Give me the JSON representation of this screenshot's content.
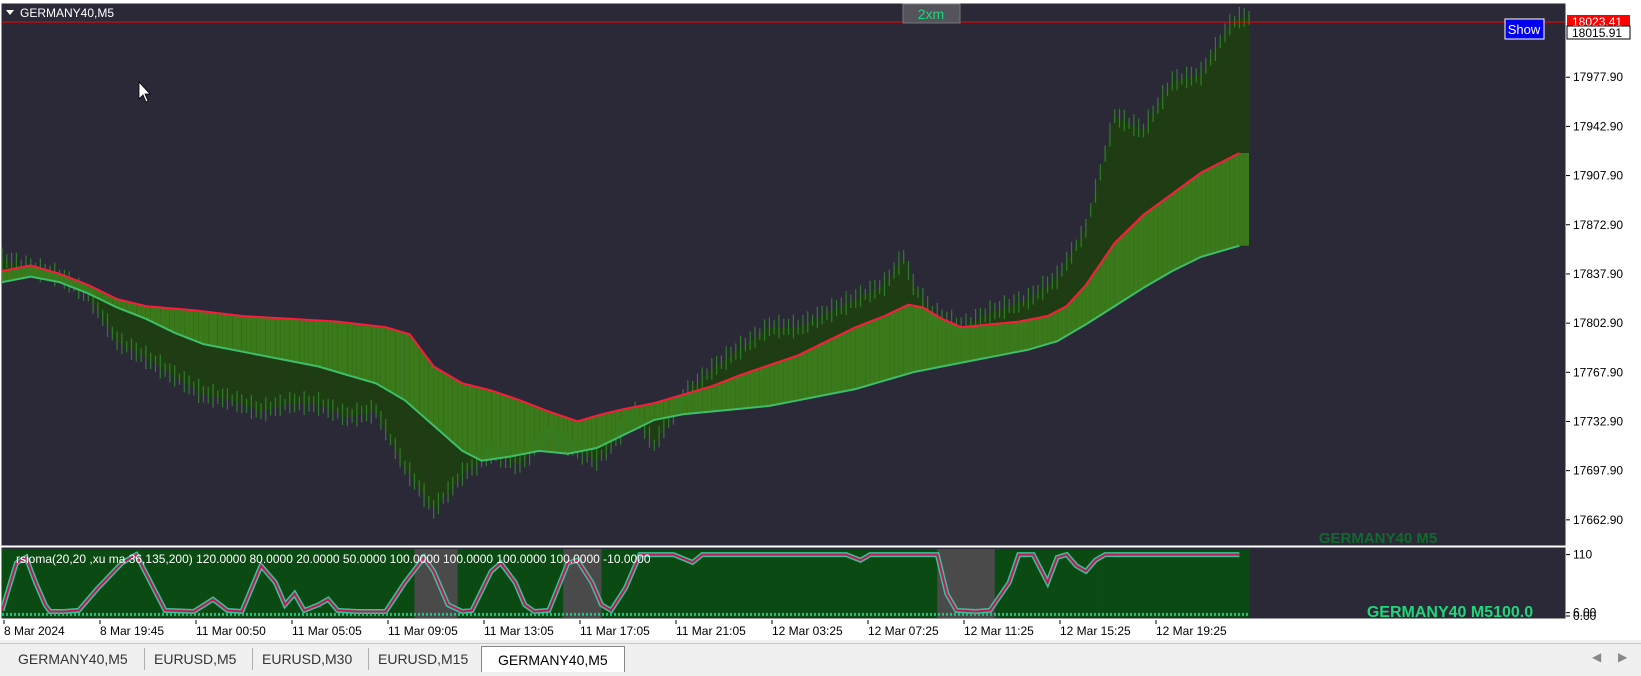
{
  "window": {
    "title": "GERMANY40,M5",
    "timeframe_button": "2xm",
    "show_button": "Show",
    "watermark_main": "GERMANY40 M5",
    "watermark_sub": "GERMANY40 M5100.0"
  },
  "colors": {
    "background": "#2b2937",
    "bear_fill": "#6b0000",
    "bull_fill": "#3a7a1a",
    "bull_band": "#1f3d12",
    "fast_line_bear": "#ff1a3c",
    "slow_line_bull": "#3dbf6a",
    "watermark": "#1fd67a",
    "price_line": "#ff0000"
  },
  "chart_data": [
    {
      "type": "line",
      "title": "GERMANY40,M5",
      "ylim": [
        17645,
        18030
      ],
      "y_ticks": [
        "17977.90",
        "17942.90",
        "17907.90",
        "17872.90",
        "17837.90",
        "17802.90",
        "17767.90",
        "17732.90",
        "17697.90",
        "17662.90"
      ],
      "current_price_labels": [
        "18023.41",
        "18015.91"
      ],
      "x_ticks": [
        "8 Mar 2024",
        "8 Mar 19:45",
        "11 Mar 00:50",
        "11 Mar 05:05",
        "11 Mar 09:05",
        "11 Mar 13:05",
        "11 Mar 17:05",
        "11 Mar 21:05",
        "12 Mar 03:25",
        "12 Mar 07:25",
        "12 Mar 11:25",
        "12 Mar 15:25",
        "12 Mar 19:25"
      ],
      "x_index_range": [
        0,
        260
      ],
      "series": [
        {
          "role": "price",
          "points": [
            [
              0,
              17848
            ],
            [
              6,
              17842
            ],
            [
              12,
              17836
            ],
            [
              18,
              17823
            ],
            [
              24,
              17790
            ],
            [
              30,
              17778
            ],
            [
              36,
              17765
            ],
            [
              42,
              17752
            ],
            [
              48,
              17748
            ],
            [
              54,
              17740
            ],
            [
              60,
              17746
            ],
            [
              66,
              17745
            ],
            [
              72,
              17736
            ],
            [
              78,
              17740
            ],
            [
              84,
              17700
            ],
            [
              90,
              17670
            ],
            [
              96,
              17695
            ],
            [
              102,
              17710
            ],
            [
              108,
              17702
            ],
            [
              114,
              17725
            ],
            [
              120,
              17712
            ],
            [
              124,
              17705
            ],
            [
              128,
              17720
            ],
            [
              132,
              17738
            ],
            [
              136,
              17716
            ],
            [
              142,
              17750
            ],
            [
              148,
              17770
            ],
            [
              154,
              17785
            ],
            [
              160,
              17800
            ],
            [
              166,
              17800
            ],
            [
              172,
              17810
            ],
            [
              178,
              17820
            ],
            [
              184,
              17830
            ],
            [
              188,
              17850
            ],
            [
              190,
              17830
            ],
            [
              194,
              17810
            ],
            [
              200,
              17800
            ],
            [
              206,
              17810
            ],
            [
              214,
              17820
            ],
            [
              220,
              17835
            ],
            [
              226,
              17870
            ],
            [
              232,
              17950
            ],
            [
              238,
              17940
            ],
            [
              244,
              17975
            ],
            [
              250,
              17980
            ],
            [
              256,
              18015
            ],
            [
              258,
              18020
            ]
          ]
        },
        {
          "role": "fast_ma",
          "points": [
            [
              0,
              17840
            ],
            [
              6,
              17844
            ],
            [
              12,
              17838
            ],
            [
              18,
              17830
            ],
            [
              24,
              17820
            ],
            [
              30,
              17815
            ],
            [
              40,
              17812
            ],
            [
              50,
              17808
            ],
            [
              60,
              17806
            ],
            [
              70,
              17804
            ],
            [
              80,
              17800
            ],
            [
              85,
              17795
            ],
            [
              90,
              17772
            ],
            [
              96,
              17760
            ],
            [
              102,
              17755
            ],
            [
              108,
              17748
            ],
            [
              114,
              17740
            ],
            [
              120,
              17733
            ],
            [
              125,
              17738
            ],
            [
              130,
              17742
            ],
            [
              136,
              17746
            ],
            [
              142,
              17752
            ],
            [
              148,
              17758
            ],
            [
              154,
              17766
            ],
            [
              160,
              17773
            ],
            [
              166,
              17780
            ],
            [
              172,
              17790
            ],
            [
              178,
              17800
            ],
            [
              184,
              17808
            ],
            [
              189,
              17816
            ],
            [
              192,
              17814
            ],
            [
              196,
              17806
            ],
            [
              200,
              17800
            ],
            [
              206,
              17802
            ],
            [
              212,
              17804
            ],
            [
              218,
              17808
            ],
            [
              222,
              17815
            ],
            [
              226,
              17830
            ],
            [
              232,
              17860
            ],
            [
              238,
              17880
            ],
            [
              244,
              17895
            ],
            [
              250,
              17910
            ],
            [
              258,
              17924
            ]
          ]
        },
        {
          "role": "slow_ma",
          "points": [
            [
              0,
              17832
            ],
            [
              6,
              17836
            ],
            [
              12,
              17832
            ],
            [
              18,
              17824
            ],
            [
              24,
              17814
            ],
            [
              30,
              17806
            ],
            [
              36,
              17796
            ],
            [
              42,
              17788
            ],
            [
              48,
              17784
            ],
            [
              54,
              17780
            ],
            [
              60,
              17776
            ],
            [
              66,
              17772
            ],
            [
              72,
              17766
            ],
            [
              78,
              17760
            ],
            [
              84,
              17748
            ],
            [
              90,
              17730
            ],
            [
              96,
              17712
            ],
            [
              100,
              17705
            ],
            [
              106,
              17708
            ],
            [
              112,
              17712
            ],
            [
              118,
              17710
            ],
            [
              124,
              17714
            ],
            [
              130,
              17724
            ],
            [
              136,
              17734
            ],
            [
              142,
              17738
            ],
            [
              148,
              17740
            ],
            [
              154,
              17742
            ],
            [
              160,
              17744
            ],
            [
              166,
              17748
            ],
            [
              172,
              17752
            ],
            [
              178,
              17756
            ],
            [
              184,
              17762
            ],
            [
              190,
              17768
            ],
            [
              196,
              17772
            ],
            [
              202,
              17776
            ],
            [
              208,
              17780
            ],
            [
              214,
              17784
            ],
            [
              220,
              17790
            ],
            [
              226,
              17802
            ],
            [
              232,
              17815
            ],
            [
              238,
              17828
            ],
            [
              244,
              17840
            ],
            [
              250,
              17850
            ],
            [
              258,
              17858
            ]
          ]
        }
      ]
    },
    {
      "type": "line",
      "title": "rsioma(20,20 ,xu ma 36,135,200) 120.0000 80.0000 20.0000 50.0000 100.0000 100.0000 100.0000 100.0000 -10.0000",
      "ylim": [
        0,
        120
      ],
      "y_ticks": [
        "110",
        "6.00",
        "0.00"
      ],
      "series": [
        {
          "role": "rsioma",
          "points": [
            [
              0,
              10
            ],
            [
              3,
              95
            ],
            [
              5,
              105
            ],
            [
              7,
              60
            ],
            [
              9,
              20
            ],
            [
              10,
              8
            ],
            [
              13,
              8
            ],
            [
              16,
              10
            ],
            [
              20,
              50
            ],
            [
              25,
              95
            ],
            [
              28,
              110
            ],
            [
              31,
              60
            ],
            [
              34,
              10
            ],
            [
              40,
              8
            ],
            [
              44,
              30
            ],
            [
              47,
              10
            ],
            [
              50,
              8
            ],
            [
              54,
              90
            ],
            [
              57,
              60
            ],
            [
              59,
              20
            ],
            [
              61,
              40
            ],
            [
              63,
              10
            ],
            [
              66,
              20
            ],
            [
              68,
              30
            ],
            [
              70,
              10
            ],
            [
              74,
              8
            ],
            [
              80,
              8
            ],
            [
              84,
              60
            ],
            [
              88,
              105
            ],
            [
              90,
              80
            ],
            [
              93,
              20
            ],
            [
              96,
              8
            ],
            [
              98,
              10
            ],
            [
              102,
              80
            ],
            [
              104,
              95
            ],
            [
              107,
              60
            ],
            [
              109,
              20
            ],
            [
              111,
              8
            ],
            [
              114,
              10
            ],
            [
              118,
              95
            ],
            [
              120,
              100
            ],
            [
              123,
              60
            ],
            [
              125,
              20
            ],
            [
              127,
              10
            ],
            [
              130,
              50
            ],
            [
              133,
              110
            ],
            [
              136,
              110
            ],
            [
              140,
              110
            ],
            [
              144,
              96
            ],
            [
              146,
              110
            ],
            [
              150,
              110
            ],
            [
              160,
              110
            ],
            [
              176,
              110
            ],
            [
              179,
              100
            ],
            [
              181,
              110
            ],
            [
              190,
              110
            ],
            [
              195,
              110
            ],
            [
              197,
              40
            ],
            [
              199,
              10
            ],
            [
              203,
              8
            ],
            [
              206,
              10
            ],
            [
              210,
              60
            ],
            [
              212,
              110
            ],
            [
              215,
              110
            ],
            [
              218,
              60
            ],
            [
              220,
              105
            ],
            [
              222,
              110
            ],
            [
              224,
              90
            ],
            [
              226,
              80
            ],
            [
              228,
              100
            ],
            [
              230,
              110
            ],
            [
              234,
              110
            ],
            [
              240,
              110
            ],
            [
              250,
              110
            ],
            [
              258,
              110
            ]
          ]
        }
      ]
    }
  ]
}
